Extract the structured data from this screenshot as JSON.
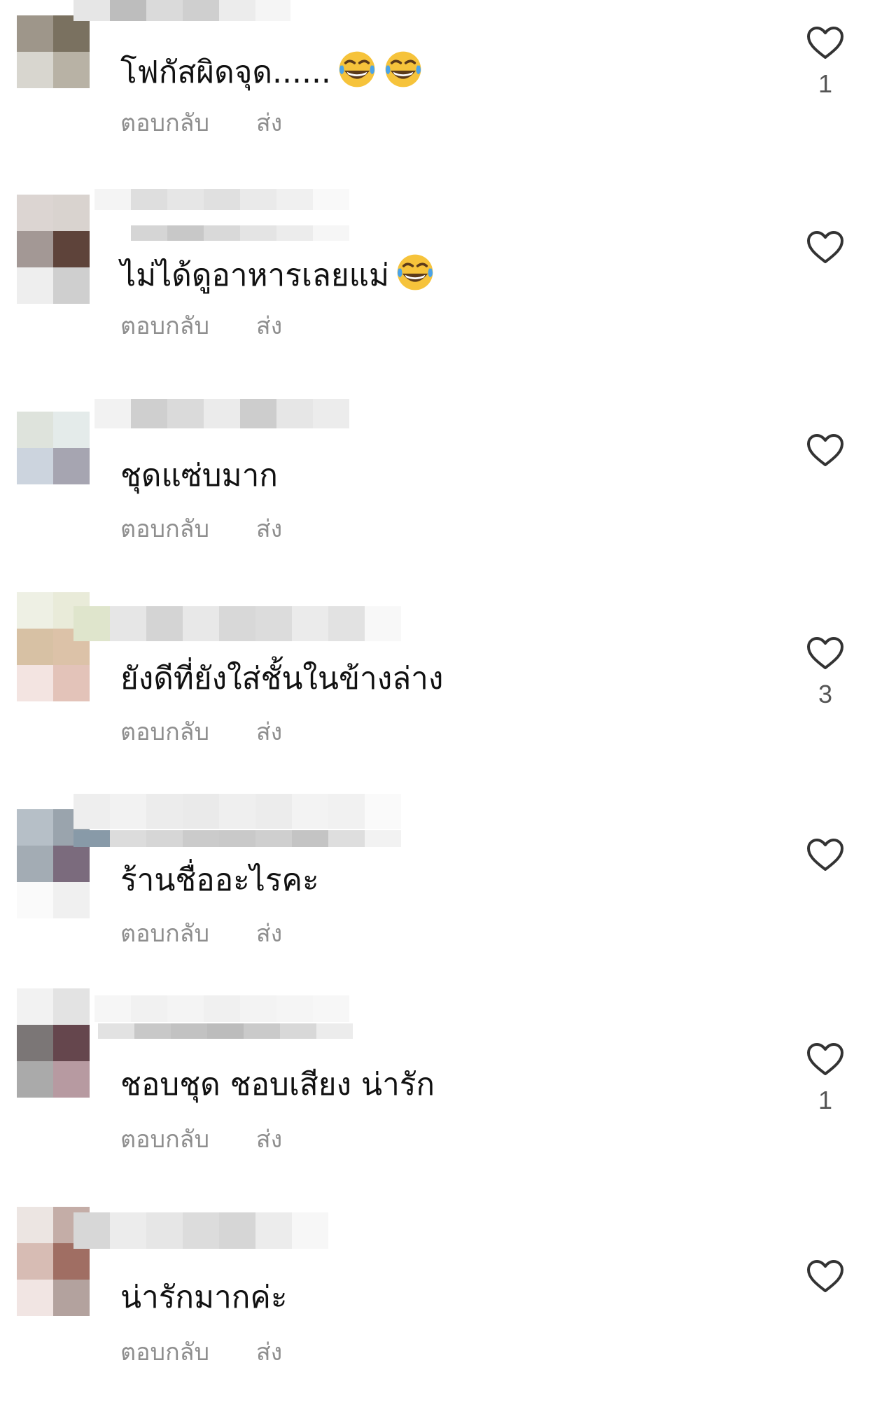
{
  "actions": {
    "reply_label": "ตอบกลับ",
    "send_label": "ส่ง"
  },
  "icons": {
    "like": "heart-outline-icon",
    "emoji": "face-with-tears-of-joy-emoji"
  },
  "colors": {
    "text": "#111111",
    "secondary_text": "#8e8e8e",
    "icon": "#555555",
    "emoji_face": "#f6c33b",
    "emoji_tear": "#4aa3e8"
  },
  "comments": [
    {
      "text": "โฟกัสผิดจุด......",
      "emoji_count": 2,
      "likes": "1",
      "avatar_colors": [
        "#7a7160",
        "#a9a593",
        "#d8d6cf",
        "#b8b2a5"
      ]
    },
    {
      "text": "ไม่ได้ดูอาหารเลยแม่",
      "emoji_count": 1,
      "likes": "",
      "avatar_colors": [
        "#d9d3cf",
        "#a39895",
        "#5e433a",
        "#cfcfcf"
      ]
    },
    {
      "text": "ชุดแซ่บมาก",
      "emoji_count": 0,
      "likes": "",
      "avatar_colors": [
        "#dee3dc",
        "#e4ebea",
        "#ccd4de",
        "#a6a5b1"
      ]
    },
    {
      "text": "ยังดีที่ยังใส่ชั้นในข้างล่าง",
      "emoji_count": 0,
      "likes": "3",
      "avatar_colors": [
        "#e9ebd9",
        "#d7c1a4",
        "#f3e4e1",
        "#e3c3b9"
      ]
    },
    {
      "text": "ร้านชื่ออะไรคะ",
      "emoji_count": 0,
      "likes": "",
      "avatar_colors": [
        "#b6bfc7",
        "#9aa4ad",
        "#7b6b7d",
        "#f2f2f2"
      ]
    },
    {
      "text": "ชอบชุด  ชอบเสียง น่ารัก",
      "emoji_count": 0,
      "likes": "1",
      "avatar_colors": [
        "#7b7676",
        "#65464d",
        "#aaaaaa",
        "#b79aa1"
      ]
    },
    {
      "text": "น่ารักมากค่ะ",
      "emoji_count": 0,
      "likes": "",
      "avatar_colors": [
        "#c4ada7",
        "#d7bcb4",
        "#a06e63",
        "#b3a29e"
      ]
    }
  ]
}
